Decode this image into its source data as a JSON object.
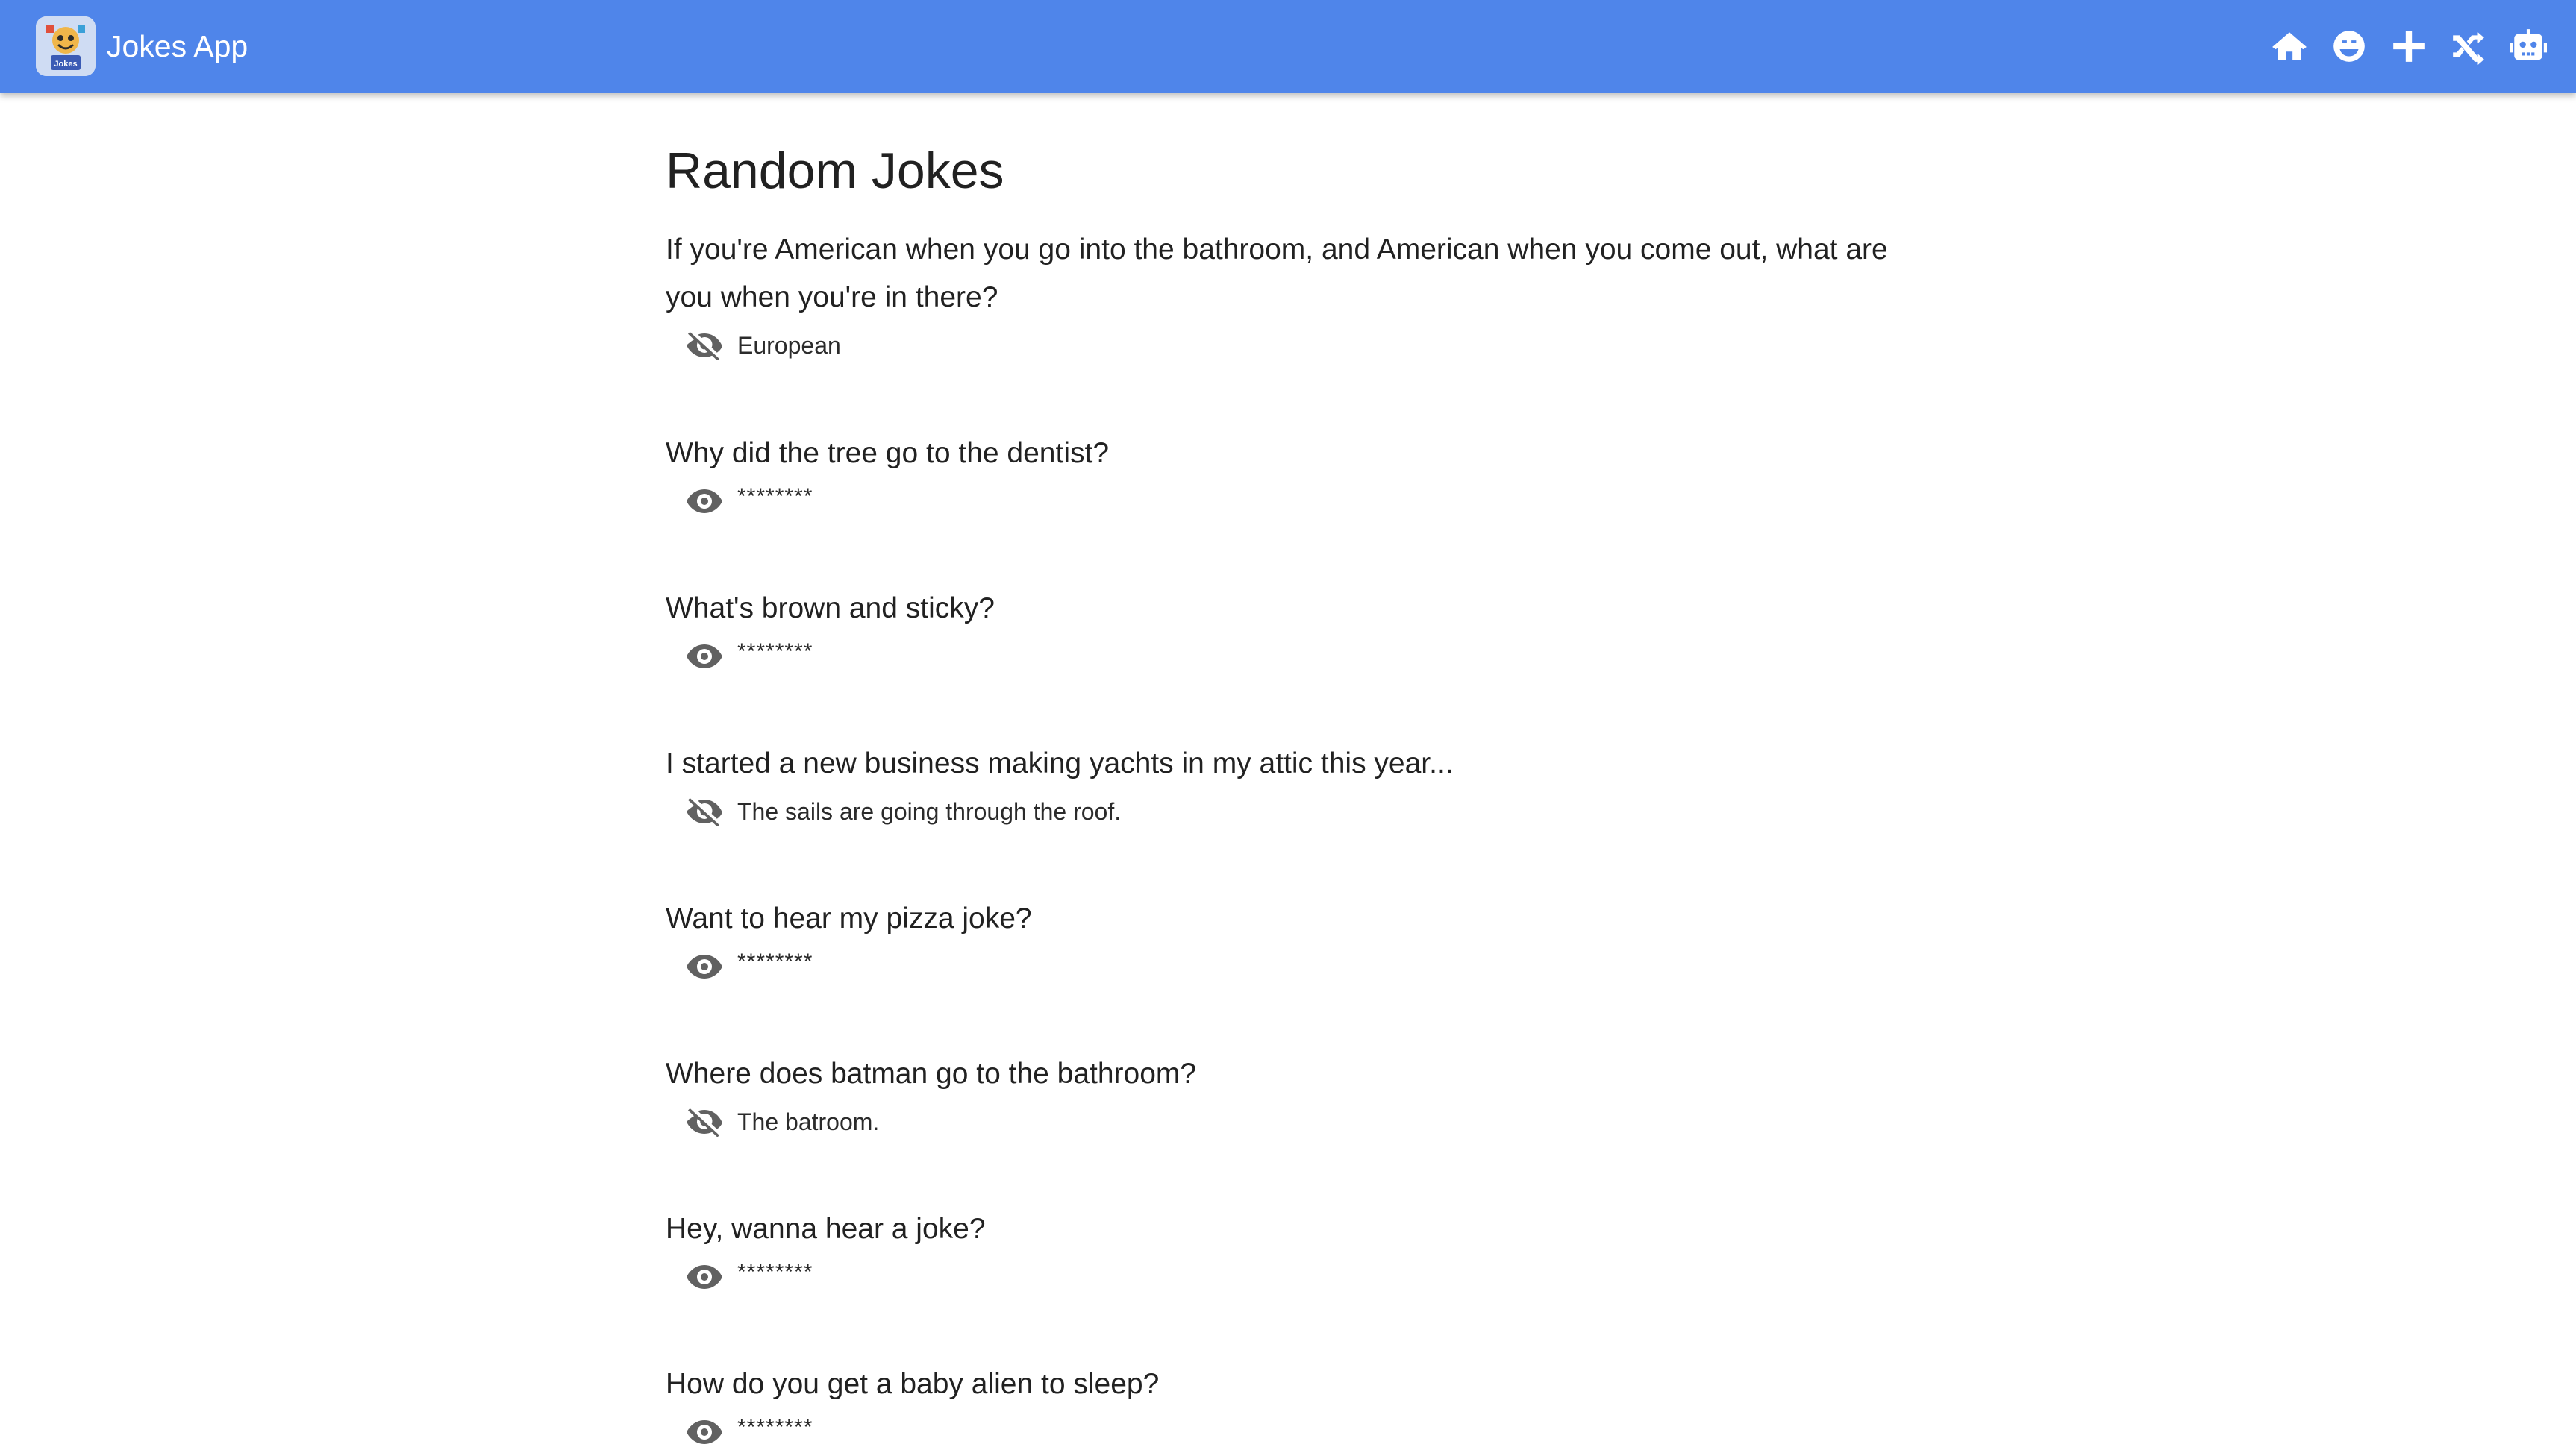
{
  "header": {
    "app_title": "Jokes App",
    "logo_icon": "jokes-app-logo",
    "nav": [
      {
        "icon": "home-icon"
      },
      {
        "icon": "smile-icon"
      },
      {
        "icon": "plus-icon"
      },
      {
        "icon": "shuffle-icon"
      },
      {
        "icon": "robot-icon"
      }
    ],
    "background_color": "#4f85ea"
  },
  "main": {
    "title": "Random Jokes",
    "jokes": [
      {
        "question": "If you're American when you go into the bathroom, and American when you come out, what are you when you're in there?",
        "answer": "European",
        "revealed": true
      },
      {
        "question": "Why did the tree go to the dentist?",
        "answer": "********",
        "revealed": false
      },
      {
        "question": "What's brown and sticky?",
        "answer": "********",
        "revealed": false
      },
      {
        "question": "I started a new business making yachts in my attic this year...",
        "answer": "The sails are going through the roof.",
        "revealed": true
      },
      {
        "question": "Want to hear my pizza joke?",
        "answer": "********",
        "revealed": false
      },
      {
        "question": "Where does batman go to the bathroom?",
        "answer": "The batroom.",
        "revealed": true
      },
      {
        "question": "Hey, wanna hear a joke?",
        "answer": "********",
        "revealed": false
      },
      {
        "question": "How do you get a baby alien to sleep?",
        "answer": "********",
        "revealed": false
      }
    ]
  }
}
